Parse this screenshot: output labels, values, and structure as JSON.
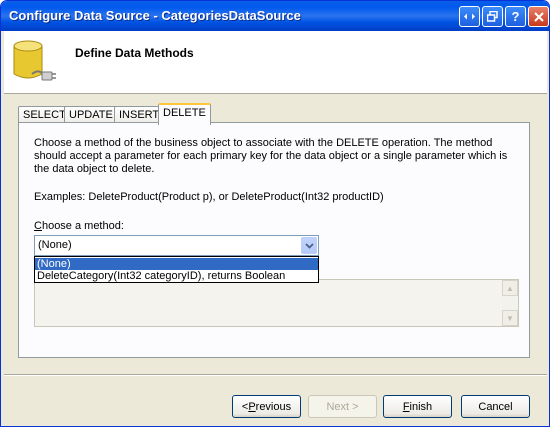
{
  "window": {
    "title": "Configure Data Source - CategoriesDataSource"
  },
  "header": {
    "title": "Define Data Methods"
  },
  "tabs": [
    {
      "label": "SELECT"
    },
    {
      "label": "UPDATE"
    },
    {
      "label": "INSERT"
    },
    {
      "label": "DELETE",
      "active": true
    }
  ],
  "panel": {
    "description": "Choose a method of the business object to associate with the DELETE operation. The method should accept a parameter for each primary key for the data object or a single parameter which is the data object to delete.",
    "examples": "Examples: DeleteProduct(Product p), or DeleteProduct(Int32 productID)",
    "choose_label_access": "C",
    "choose_label_rest": "hoose a method:",
    "method_value": "(None)",
    "method_options": [
      "(None)",
      "DeleteCategory(Int32 categoryID), returns Boolean"
    ]
  },
  "buttons": {
    "previous_prefix": "< ",
    "previous_access": "P",
    "previous_rest": "revious",
    "next": "Next >",
    "finish_access": "F",
    "finish_rest": "inish",
    "cancel": "Cancel"
  },
  "colors": {
    "titlebar": "#0054e3",
    "tab_active_highlight": "#ffc83c",
    "selection": "#316ac5"
  }
}
